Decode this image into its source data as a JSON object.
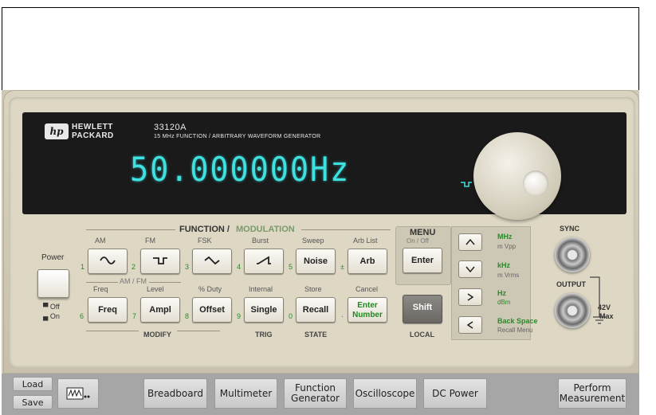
{
  "instrument": {
    "brand_line1": "HEWLETT",
    "brand_line2": "PACKARD",
    "logo": "hp",
    "model": "33120A",
    "subtitle": "15 MHz  FUNCTION / ARBITRARY WAVEFORM GENERATOR",
    "display_value": "50.000000Hz",
    "display_color": "#3fe0e0",
    "active_waveform_icon": "square-wave-icon"
  },
  "labels": {
    "function_modulation_a": "FUNCTION /",
    "function_modulation_b": "MODULATION",
    "am": "AM",
    "fm": "FM",
    "fsk": "FSK",
    "burst": "Burst",
    "sweep": "Sweep",
    "arb_list": "Arb List",
    "am_fm": "AM / FM",
    "freq": "Freq",
    "level": "Level",
    "pct_duty": "% Duty",
    "internal": "Internal",
    "store": "Store",
    "cancel": "Cancel",
    "modify": "MODIFY",
    "trig": "TRIG",
    "state": "STATE",
    "local": "LOCAL",
    "menu": "MENU",
    "menu_onoff": "On / Off",
    "power": "Power",
    "off": "Off",
    "on": "On",
    "mhz": "MHz",
    "mvpp": "m Vpp",
    "khz": "kHz",
    "mvrms": "m Vrms",
    "hz": "Hz",
    "dbm": "dBm",
    "back_space": "Back Space",
    "recall_menu": "Recall Menu",
    "sync": "SYNC",
    "output": "OUTPUT",
    "max_v": "42V",
    "max": "Max",
    "n1": "1",
    "n2": "2",
    "n3": "3",
    "n4": "4",
    "n5": "5",
    "pm": "±",
    "n6": "6",
    "n7": "7",
    "n8": "8",
    "n9": "9",
    "n0": "0",
    "dot": "."
  },
  "buttons": {
    "noise": "Noise",
    "arb": "Arb",
    "enter": "Enter",
    "freq": "Freq",
    "ampl": "Ampl",
    "offset": "Offset",
    "single": "Single",
    "recall": "Recall",
    "enter_number_1": "Enter",
    "enter_number_2": "Number",
    "shift": "Shift"
  },
  "toolbar": {
    "load": "Load",
    "save": "Save",
    "breadboard": "Breadboard",
    "multimeter": "Multimeter",
    "function_generator_1": "Function",
    "function_generator_2": "Generator",
    "oscilloscope": "Oscilloscope",
    "dc_power": "DC Power",
    "perform_1": "Perform",
    "perform_2": "Measurement"
  }
}
